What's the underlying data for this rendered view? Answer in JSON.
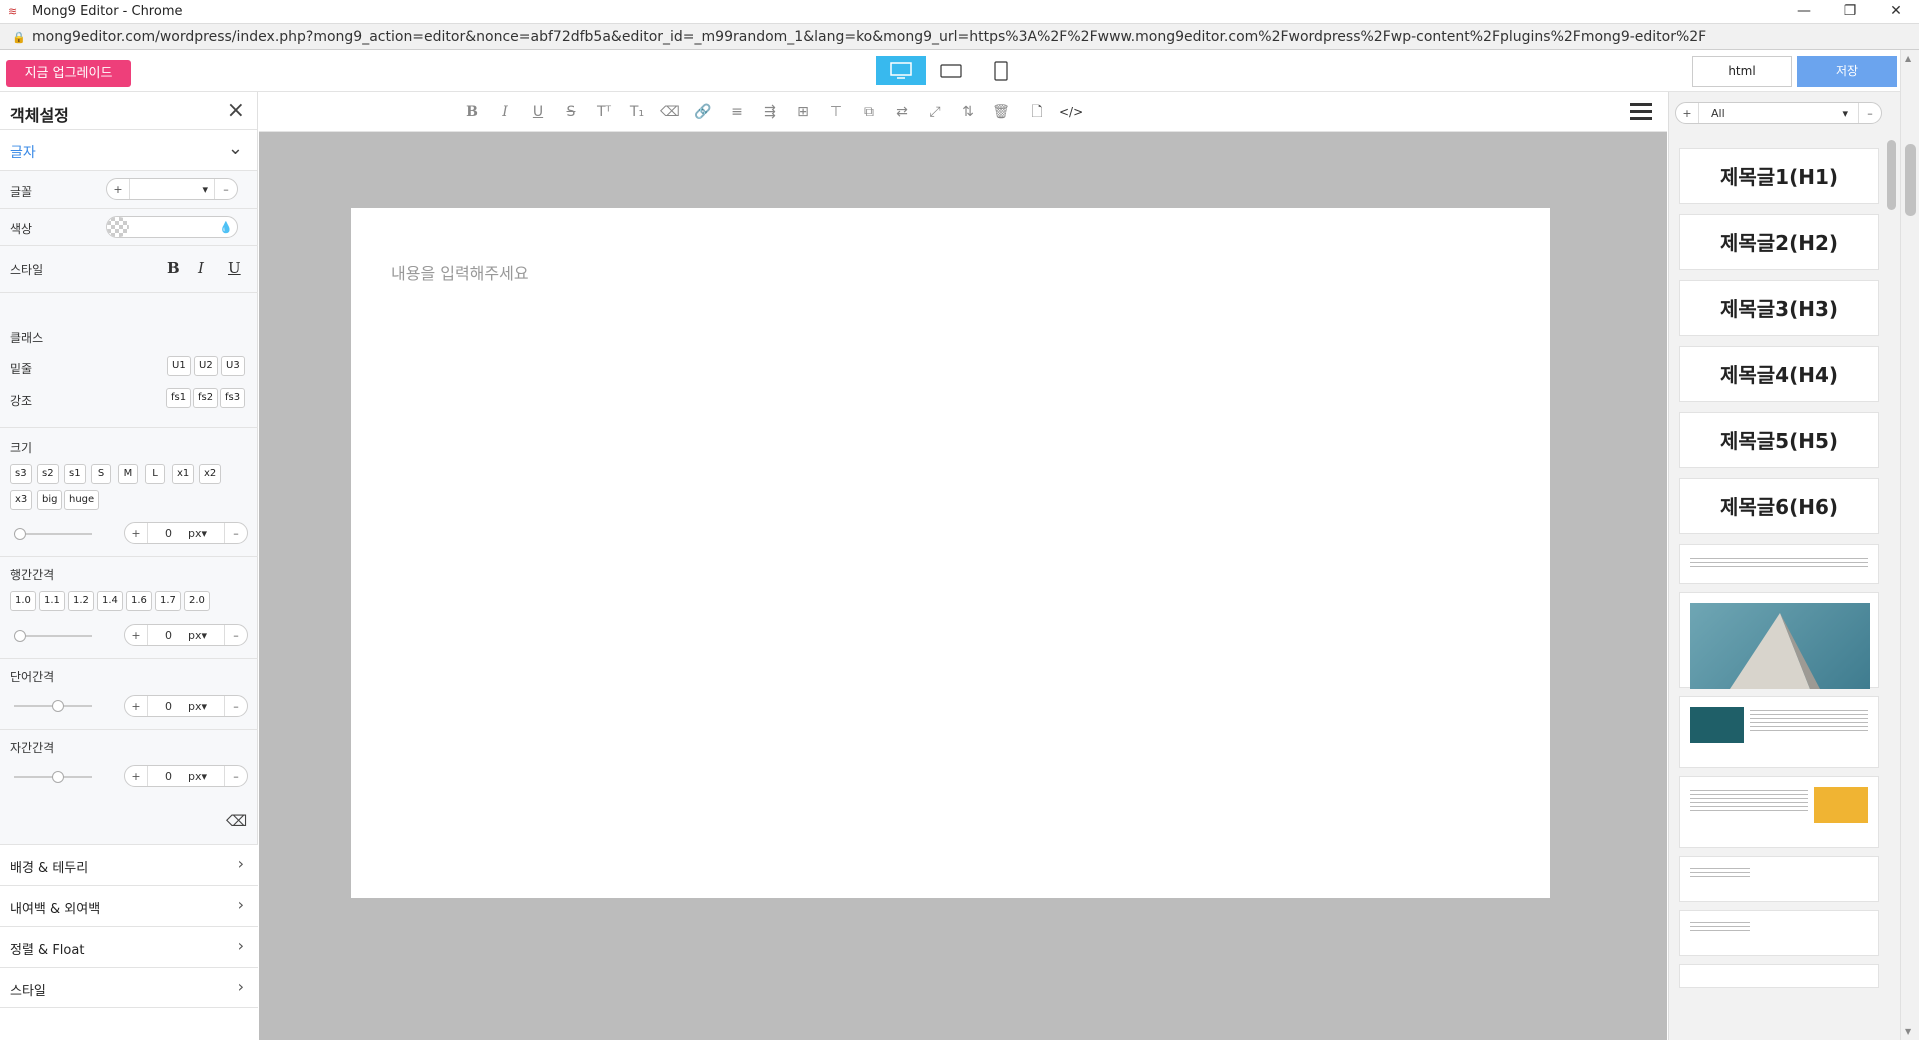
{
  "window": {
    "title": "Mong9 Editor - Chrome",
    "url": "mong9editor.com/wordpress/index.php?mong9_action=editor&nonce=abf72dfb5a&editor_id=_m99random_1&lang=ko&mong9_url=https%3A%2F%2Fwww.mong9editor.com%2Fwordpress%2Fwp-content%2Fplugins%2Fmong9-editor%2F"
  },
  "topbar": {
    "upgrade": "지금 업그레이드",
    "html": "html",
    "save": "저장"
  },
  "left": {
    "title": "객체설정",
    "section": "글자",
    "font_label": "글꼴",
    "color_label": "색상",
    "style_label": "스타일",
    "style_b": "B",
    "style_i": "I",
    "style_u": "U",
    "class_label": "클래스",
    "underline_label": "밑줄",
    "underline": [
      "U1",
      "U2",
      "U3"
    ],
    "emph_label": "강조",
    "emph": [
      "fs1",
      "fs2",
      "fs3"
    ],
    "size_label": "크기",
    "sizes": [
      "s3",
      "s2",
      "s1",
      "S",
      "M",
      "L",
      "x1",
      "x2",
      "x3",
      "big",
      "huge"
    ],
    "size_value": "0",
    "unit": "px",
    "lh_label": "행간간격",
    "lh": [
      "1.0",
      "1.1",
      "1.2",
      "1.4",
      "1.6",
      "1.7",
      "2.0"
    ],
    "lh_value": "0",
    "word_label": "단어간격",
    "word_value": "0",
    "letter_label": "자간간격",
    "letter_value": "0",
    "acc": [
      "배경 & 테두리",
      "내여백 & 외여백",
      "정렬 & Float",
      "스타일"
    ]
  },
  "editor": {
    "placeholder": "내용을 입력해주세요"
  },
  "right": {
    "filter": "All",
    "headings": [
      "제목글1(H1)",
      "제목글2(H2)",
      "제목글3(H3)",
      "제목글4(H4)",
      "제목글5(H5)",
      "제목글6(H6)"
    ]
  },
  "colors": {
    "accent": "#38b9ee",
    "upgrade": "#ee3f7a",
    "save": "#6ba4ee",
    "canvas": "#bcbcbc"
  }
}
